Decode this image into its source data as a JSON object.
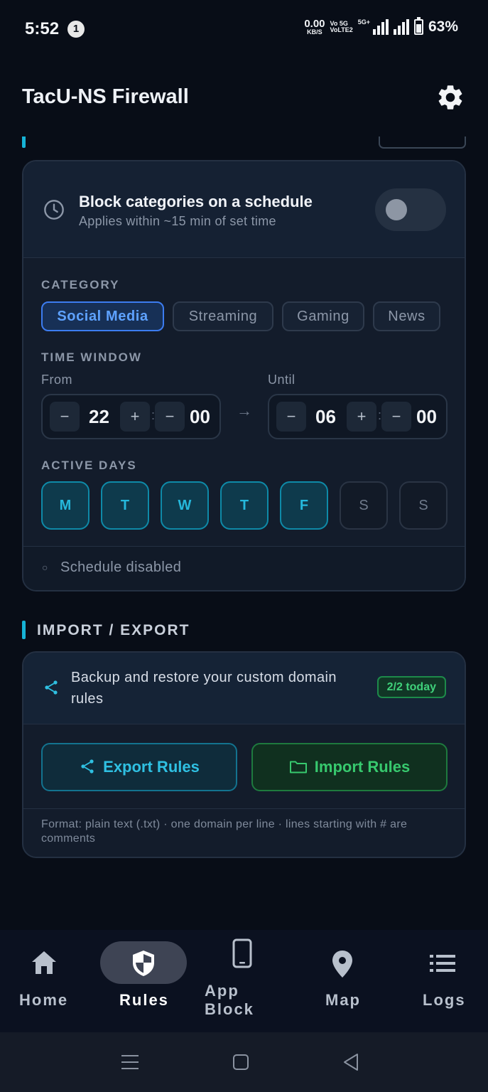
{
  "status_bar": {
    "time": "5:52",
    "notification_count": "1",
    "net_speed_value": "0.00",
    "net_speed_unit": "KB/S",
    "volte_top": "Vo 5G",
    "volte_bottom": "VoLTE2",
    "network_type": "5G+",
    "battery_percent": "63%"
  },
  "header": {
    "title": "TacU-NS Firewall",
    "settings_icon": "gear-icon"
  },
  "scheduled_blocking": {
    "card_title": "Block categories on a schedule",
    "card_subtitle": "Applies within ~15 min of set time",
    "toggle_on": false,
    "category_label": "CATEGORY",
    "categories": [
      {
        "label": "Social Media",
        "selected": true
      },
      {
        "label": "Streaming",
        "selected": false
      },
      {
        "label": "Gaming",
        "selected": false
      },
      {
        "label": "News",
        "selected": false
      }
    ],
    "time_window_label": "TIME WINDOW",
    "from_label": "From",
    "until_label": "Until",
    "from_hour": "22",
    "from_minute": "00",
    "until_hour": "06",
    "until_minute": "00",
    "minus": "−",
    "plus": "+",
    "colon": ":",
    "arrow": "→",
    "active_days_label": "ACTIVE DAYS",
    "days": [
      {
        "label": "M",
        "active": true
      },
      {
        "label": "T",
        "active": true
      },
      {
        "label": "W",
        "active": true
      },
      {
        "label": "T",
        "active": true
      },
      {
        "label": "F",
        "active": true
      },
      {
        "label": "S",
        "active": false
      },
      {
        "label": "S",
        "active": false
      }
    ],
    "status_bullet": "○",
    "status_text": "Schedule disabled"
  },
  "import_export": {
    "section_title": "IMPORT / EXPORT",
    "description": "Backup and restore your custom domain rules",
    "quota_badge": "2/2 today",
    "export_label": "Export Rules",
    "import_label": "Import Rules",
    "format_note": "Format: plain text (.txt) · one domain per line · lines starting with # are comments"
  },
  "bottom_nav": {
    "items": [
      {
        "label": "Home",
        "icon": "home-icon",
        "active": false
      },
      {
        "label": "Rules",
        "icon": "shield-icon",
        "active": true
      },
      {
        "label": "App Block",
        "icon": "phone-icon",
        "active": false
      },
      {
        "label": "Map",
        "icon": "map-pin-icon",
        "active": false
      },
      {
        "label": "Logs",
        "icon": "list-icon",
        "active": false
      }
    ]
  },
  "colors": {
    "background": "#080d17",
    "accent_cyan": "#16b3d6",
    "accent_blue": "#3c7cf0",
    "accent_green": "#37c96e"
  }
}
